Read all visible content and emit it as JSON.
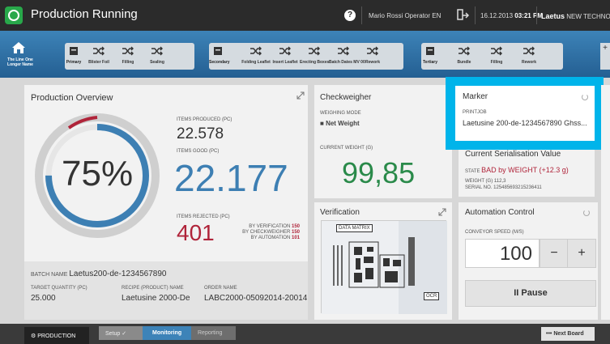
{
  "titlebar": {
    "title": "Production Running",
    "user": "Mario Rossi Operator EN",
    "date": "16.12.2013",
    "time": "03:21 PM",
    "brand_bold": "Laetus",
    "brand_rest": "NEW TECHNOLOGY",
    "colors": {
      "logo": "#28a84a",
      "bar": "#2b2b2b"
    }
  },
  "nav": {
    "home_label": "The Line One Longer Name",
    "groups": [
      {
        "label": "Primary",
        "steps": [
          "Blister Foil",
          "Filling",
          "Sealing"
        ]
      },
      {
        "label": "Secondary",
        "steps": [
          "Folding Leaflet",
          "Insert Leaflet",
          "Erecting Boxes",
          "Batch Dates MV 00",
          "Rework"
        ]
      },
      {
        "label": "Tertiary",
        "steps": [
          "Bundle",
          "Filling",
          "Rework"
        ]
      }
    ]
  },
  "overview": {
    "title": "Production Overview",
    "percent": "75%",
    "progress": 0.75,
    "produced_label": "ITEMS PRODUCED (pc)",
    "produced": "22.578",
    "good_label": "ITEMS GOOD (pc)",
    "good": "22.177",
    "rejected_label": "ITEMS REJECTED (pc)",
    "rejected": "401",
    "reject_rows": [
      {
        "label": "BY VERIFICATION",
        "value": "150"
      },
      {
        "label": "BY CHECKWEIGHER",
        "value": "150"
      },
      {
        "label": "BY AUTOMATION",
        "value": "101"
      }
    ],
    "batch_label": "BATCH NAME",
    "batch": "Laetus200-de-1234567890",
    "target_label": "TARGET QUANTITY (pc)",
    "target": "25.000",
    "recipe_label": "RECIPE (PRODUCT) NAME",
    "recipe": "Laetusine 2000-De",
    "order_label": "ORDER NAME",
    "order": "LABC2000-05092014-20014"
  },
  "checkweigher": {
    "title": "Checkweigher",
    "mode_label": "WEIGHING MODE",
    "mode": "Net Weight",
    "weight_label": "CURRENT WEIGHT (g)",
    "weight": "99,85"
  },
  "verification": {
    "title": "Verification",
    "tag1": "DATA MATRIX",
    "tag2": "OCR"
  },
  "marker": {
    "title": "Marker",
    "job_label": "PRINTJOB",
    "job": "Laetusine 200-de-1234567890 Ghss..."
  },
  "serial": {
    "title": "Current Serialisation Value",
    "state_label": "STATE",
    "state": "BAD by WEIGHT (+12.3 g)",
    "weight_label": "WEIGHT (g)",
    "weight": "112,3",
    "serial_label": "SERIAL NO.",
    "serial": "125485693215236411"
  },
  "automation": {
    "title": "Automation Control",
    "speed_label": "CONVEYOR SPEED (m/s)",
    "speed": "100",
    "minus": "−",
    "plus": "+",
    "pause": "II Pause"
  },
  "footer": {
    "module": "PRODUCTION",
    "steps": [
      "Setup",
      "Monitoring",
      "Reporting"
    ],
    "check": "✓",
    "next": "Next Board",
    "dots": "•••"
  }
}
